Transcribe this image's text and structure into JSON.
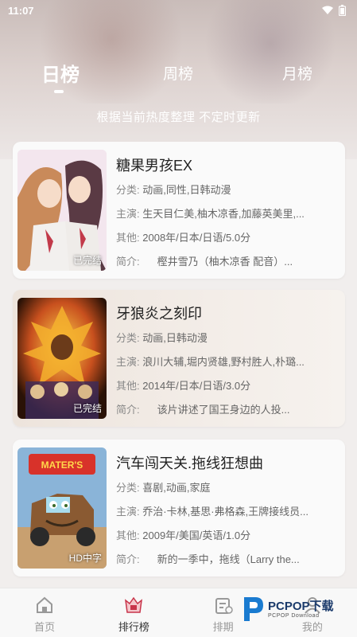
{
  "status_bar": {
    "time": "11:07"
  },
  "tabs": [
    {
      "label": "日榜",
      "active": true
    },
    {
      "label": "周榜",
      "active": false
    },
    {
      "label": "月榜",
      "active": false
    }
  ],
  "subtitle": "根据当前热度整理 不定时更新",
  "items": [
    {
      "title": "糖果男孩EX",
      "category_label": "分类:",
      "category": "动画,同性,日韩动漫",
      "cast_label": "主演:",
      "cast": "生天目仁美,柚木凉香,加藤英美里,...",
      "other_label": "其他:",
      "other": "2008年/日本/日语/5.0分",
      "intro_label": "简介:",
      "intro": "樫井雪乃（柚木凉香 配音）...",
      "cover_tag": "已完结"
    },
    {
      "title": "牙狼炎之刻印",
      "category_label": "分类:",
      "category": "动画,日韩动漫",
      "cast_label": "主演:",
      "cast": "浪川大辅,堀内贤雄,野村胜人,朴璐...",
      "other_label": "其他:",
      "other": "2014年/日本/日语/3.0分",
      "intro_label": "简介:",
      "intro": "该片讲述了国王身边的人投...",
      "cover_tag": "已完结"
    },
    {
      "title": "汽车闯天关.拖线狂想曲",
      "category_label": "分类:",
      "category": "喜剧,动画,家庭",
      "cast_label": "主演:",
      "cast": "乔治·卡林,基思·弗格森,王牌接线员...",
      "other_label": "其他:",
      "other": "2009年/美国/英语/1.0分",
      "intro_label": "简介:",
      "intro": "新的一季中，拖线（Larry the...",
      "cover_tag": "HD中字",
      "cover_logo": "MATER'S"
    }
  ],
  "bottom_nav": [
    {
      "label": "首页",
      "icon": "home-icon"
    },
    {
      "label": "排行榜",
      "icon": "ranking-icon",
      "active": true
    },
    {
      "label": "排期",
      "icon": "schedule-icon"
    },
    {
      "label": "我的",
      "icon": "profile-icon"
    }
  ],
  "watermark": {
    "title": "PCPOP下载",
    "subtitle": "PCPOP Download"
  },
  "colors": {
    "accent": "#c8344a",
    "nav_active": "#333333",
    "nav_inactive": "#999999"
  }
}
